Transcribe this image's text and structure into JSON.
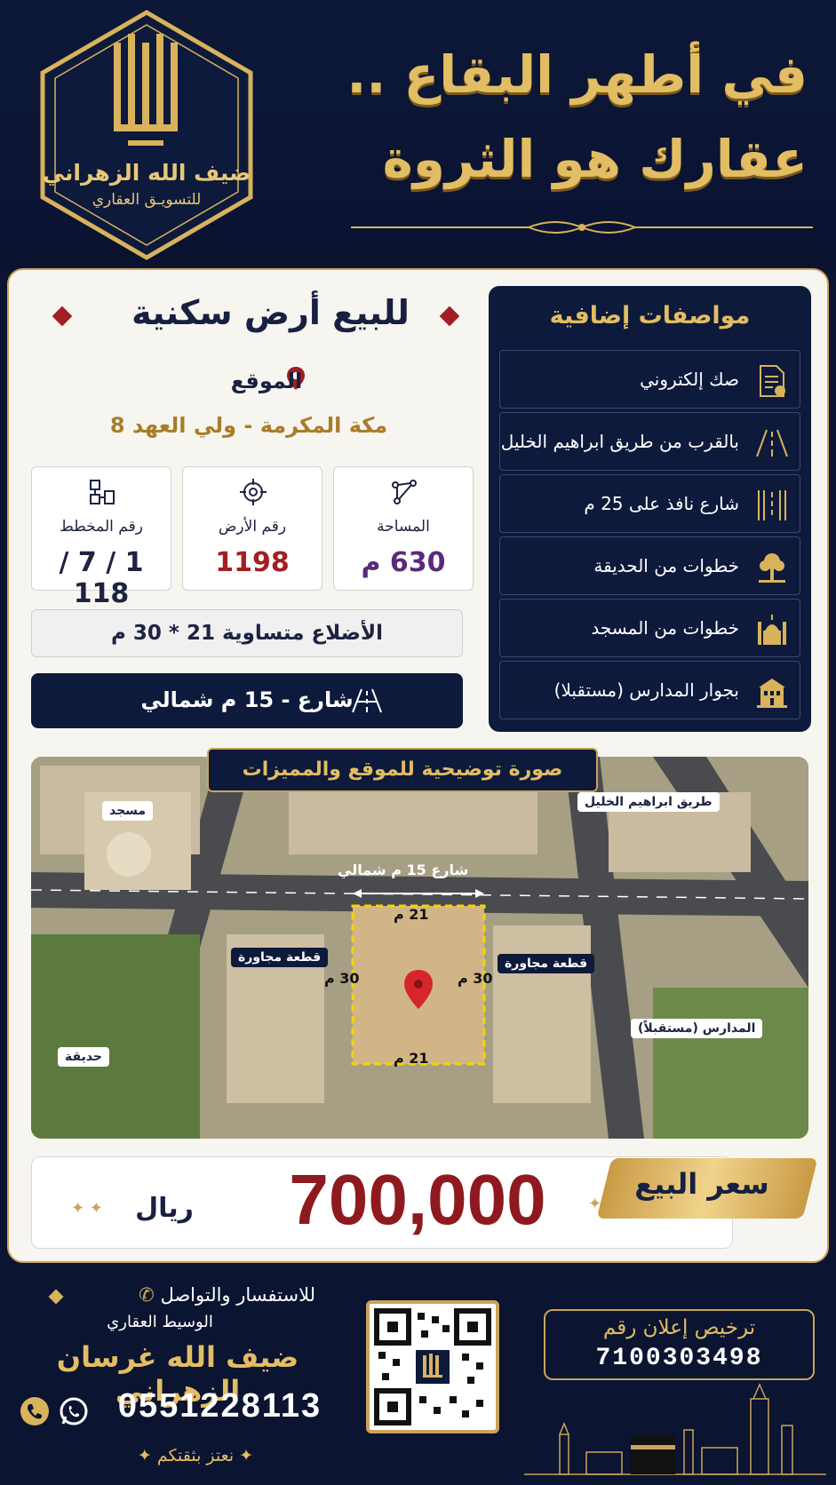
{
  "brand": {
    "name": "ضيف الله الزهراني",
    "subtitle": "للتسويـق العقاري"
  },
  "headline": {
    "line1": "في أطهر البقاع ..",
    "line2": "عقارك هو الثروة"
  },
  "listing": {
    "title": "للبيع أرض سكنية",
    "location_label": "الموقع",
    "location_value": "مكة المكرمة - ولي العهد 8",
    "stats": [
      {
        "label": "المساحة",
        "value": "630 م",
        "icon": "area-icon",
        "color": "#5a2a7a"
      },
      {
        "label": "رقم الأرض",
        "value": "1198",
        "icon": "target-icon",
        "color": "#a31e22"
      },
      {
        "label": "رقم المخطط",
        "value": "1 / 7 / 118",
        "icon": "plan-icon",
        "color": "#1d2340"
      }
    ],
    "sides": "الأضلاع متساوية 21 * 30 م",
    "street": "شارع - 15 م شمالي"
  },
  "features": {
    "title": "مواصفات إضافية",
    "items": [
      {
        "label": "صك إلكتروني",
        "icon": "document-icon"
      },
      {
        "label": "بالقرب من طريق ابراهيم الخليل",
        "icon": "road-icon"
      },
      {
        "label": "شارع نافذ على 25 م",
        "icon": "street-icon"
      },
      {
        "label": "خطوات من الحديقة",
        "icon": "tree-icon"
      },
      {
        "label": "خطوات من المسجد",
        "icon": "mosque-icon"
      },
      {
        "label": "بجوار المدارس (مستقبلا)",
        "icon": "school-icon"
      }
    ]
  },
  "map": {
    "banner": "صورة توضيحية للموقع والمميزات",
    "labels": {
      "mosque": "مسجد",
      "road": "طريق ابراهيم الخليل",
      "street": "شارع 15 م شمالي",
      "neighbor_left": "قطعة مجاورة",
      "neighbor_right": "قطعة مجاورة",
      "schools": "المدارس (مستقبلاً)",
      "park": "حديقة",
      "dim_top": "21 م",
      "dim_bottom": "21 م",
      "dim_left": "30 م",
      "dim_right": "30 م"
    }
  },
  "price": {
    "label": "سعر البيع",
    "value": "700,000",
    "currency": "ريال"
  },
  "contact": {
    "inquiry": "للاستفسار والتواصل",
    "broker": "الوسيط العقاري",
    "name": "ضيف الله غرسان الزهراني",
    "phone": "0551228113",
    "slogan": "نعتز بثقتكم"
  },
  "license": {
    "label": "ترخيص إعلان رقم",
    "number": "7100303498"
  },
  "colors": {
    "navy": "#0b1430",
    "gold": "#d8b35c",
    "red": "#a31e22"
  }
}
